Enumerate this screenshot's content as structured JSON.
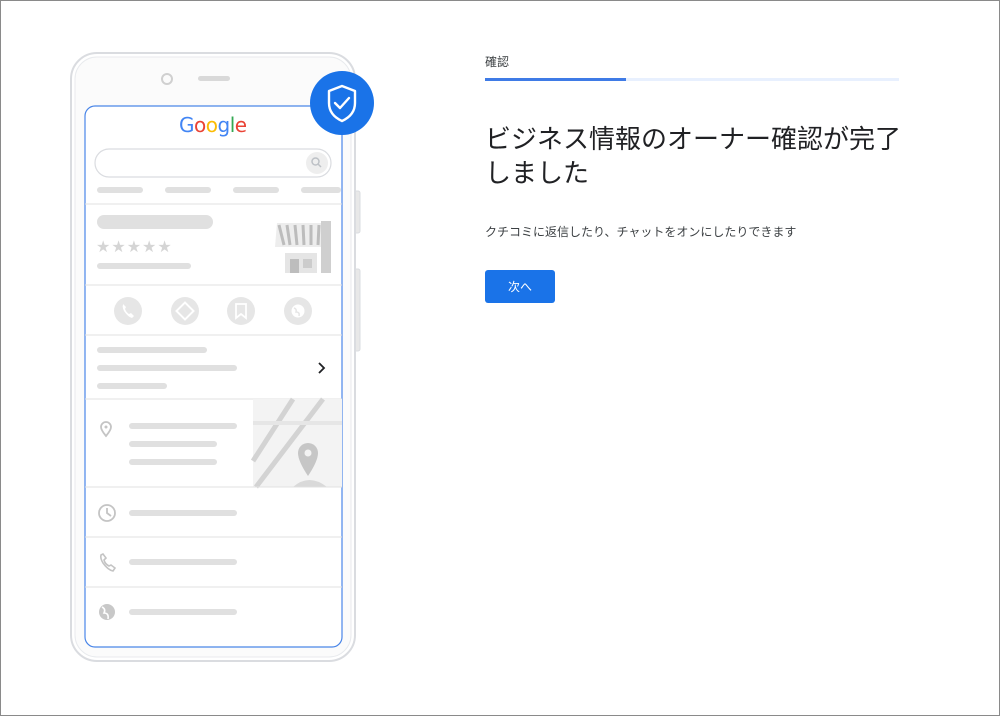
{
  "illustration": {
    "logo_letters": [
      {
        "char": "G",
        "color": "#4285f4"
      },
      {
        "char": "o",
        "color": "#ea4335"
      },
      {
        "char": "o",
        "color": "#fbbc05"
      },
      {
        "char": "g",
        "color": "#4285f4"
      },
      {
        "char": "l",
        "color": "#34a853"
      },
      {
        "char": "e",
        "color": "#ea4335"
      }
    ],
    "star_rating": "★★★★★",
    "colors": {
      "accent": "#1a73e8",
      "outline": "#dadce0",
      "placeholder": "#e0e0e0",
      "icon": "#bdc1c6"
    },
    "icons": [
      "verified-shield-icon",
      "search-icon",
      "store-icon",
      "phone-icon",
      "directions-icon",
      "bookmark-icon",
      "globe-icon",
      "chevron-right-icon",
      "location-pin-icon",
      "map-pin-icon",
      "clock-icon"
    ]
  },
  "panel": {
    "step_label": "確認",
    "progress": 0.34,
    "title": "ビジネス情報のオーナー確認が完了しました",
    "description": "クチコミに返信したり、チャットをオンにしたりできます",
    "next_button": "次へ"
  }
}
